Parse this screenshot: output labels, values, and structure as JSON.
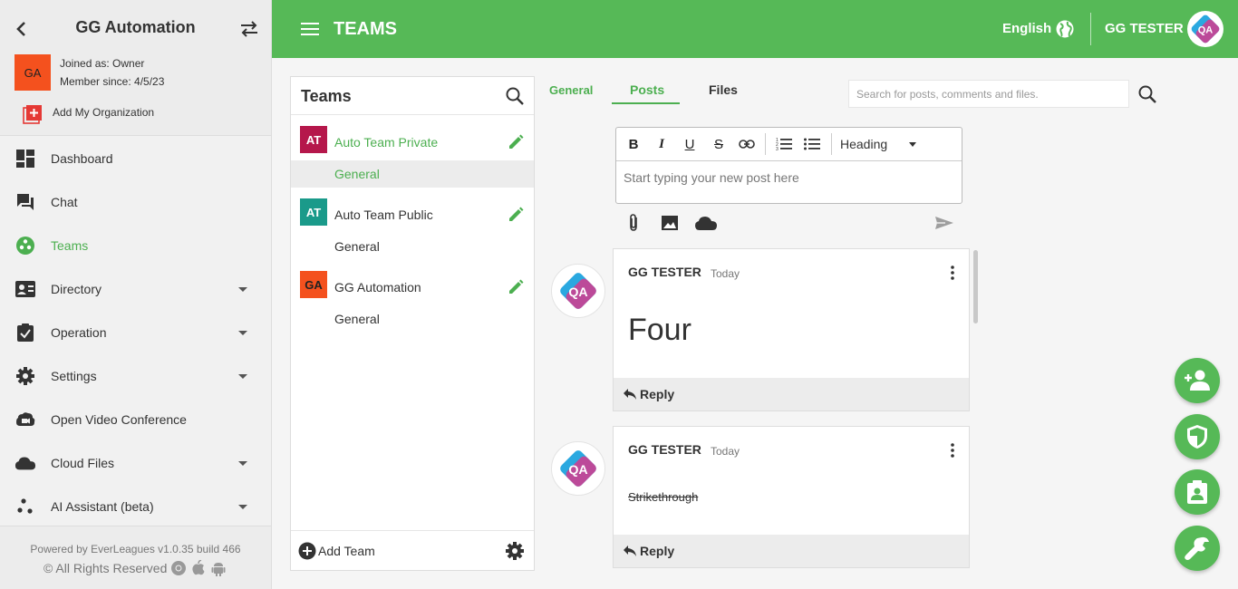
{
  "sidebar": {
    "title": "GG Automation",
    "org_badge": "GA",
    "joined_as": "Joined as: Owner",
    "member_since": "Member since: 4/5/23",
    "add_org_label": "Add My Organization",
    "nav": [
      {
        "label": "Dashboard",
        "icon": "dashboard-icon"
      },
      {
        "label": "Chat",
        "icon": "chat-icon"
      },
      {
        "label": "Teams",
        "icon": "teams-icon",
        "active": true
      },
      {
        "label": "Directory",
        "icon": "directory-icon",
        "expandable": true
      },
      {
        "label": "Operation",
        "icon": "operation-icon",
        "expandable": true
      },
      {
        "label": "Settings",
        "icon": "gear-icon",
        "expandable": true
      },
      {
        "label": "Open Video Conference",
        "icon": "video-icon"
      },
      {
        "label": "Cloud Files",
        "icon": "cloud-icon",
        "expandable": true
      },
      {
        "label": "AI Assistant (beta)",
        "icon": "ai-icon",
        "expandable": true
      }
    ],
    "footer": {
      "powered_by": "Powered by EverLeagues v1.0.35 build 466",
      "rights": "© All Rights Reserved"
    }
  },
  "topbar": {
    "title": "TEAMS",
    "language": "English",
    "user": "GG TESTER",
    "avatar_text": "QA"
  },
  "teams_panel": {
    "title": "Teams",
    "teams": [
      {
        "badge": "AT",
        "badge_color": "#b5174b",
        "name": "Auto Team Private",
        "active": true,
        "channel": "General"
      },
      {
        "badge": "AT",
        "badge_color": "#1a9a8a",
        "name": "Auto Team Public",
        "channel": "General"
      },
      {
        "badge": "GA",
        "badge_color": "#f4511e",
        "name": "GG Automation",
        "channel": "General"
      }
    ],
    "add_team_label": "Add Team"
  },
  "tabs": {
    "channel": "General",
    "posts": "Posts",
    "files": "Files"
  },
  "search": {
    "placeholder": "Search for posts, comments and files."
  },
  "editor": {
    "heading_select": "Heading",
    "placeholder": "Start typing your new post here"
  },
  "posts": [
    {
      "author": "GG TESTER",
      "time": "Today",
      "body": "Four",
      "reply_label": "Reply"
    },
    {
      "author": "GG TESTER",
      "time": "Today",
      "body": "Strikethrough",
      "reply_label": "Reply"
    }
  ],
  "colors": {
    "brand_green": "#56b957",
    "accent_green": "#4caf50"
  }
}
